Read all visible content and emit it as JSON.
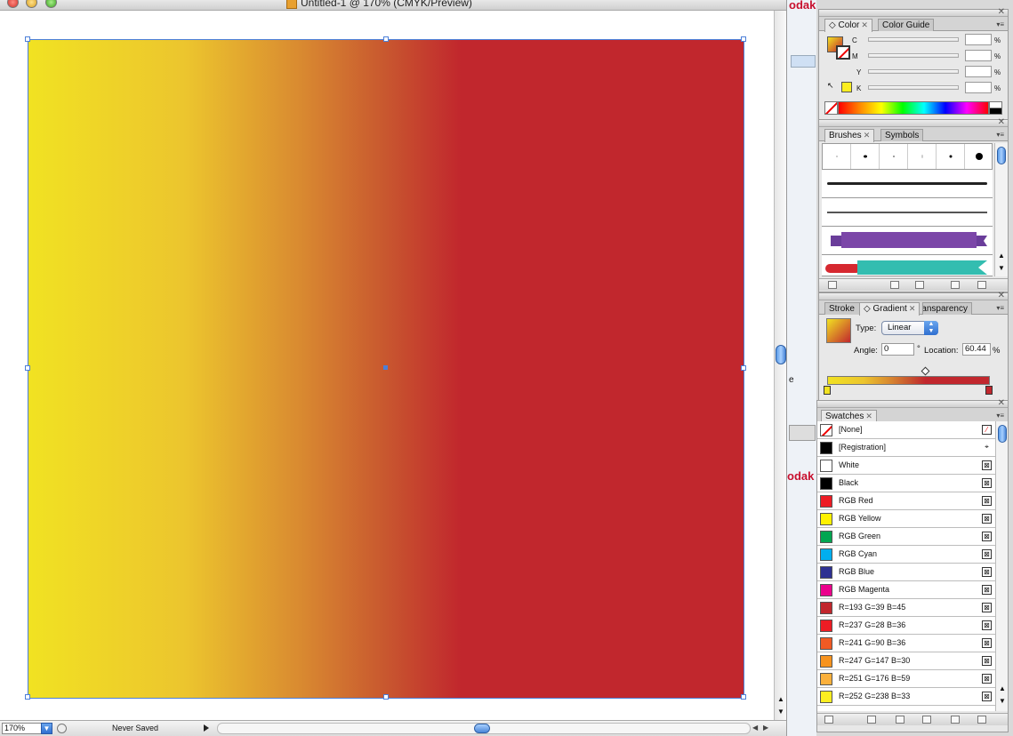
{
  "document": {
    "title": "Untitled-1 @ 170% (CMYK/Preview)",
    "zoom": "170%",
    "status": "Never Saved"
  },
  "color_panel": {
    "tabs": [
      "Color",
      "Color Guide"
    ],
    "channels": [
      "C",
      "M",
      "Y",
      "K"
    ],
    "unit": "%"
  },
  "brushes_panel": {
    "tabs": [
      "Brushes",
      "Symbols"
    ]
  },
  "gradient_panel": {
    "tabs": [
      "Stroke",
      "Gradient",
      "Transparency"
    ],
    "type_label": "Type:",
    "type_value": "Linear",
    "angle_label": "Angle:",
    "angle_value": "0",
    "degree_symbol": "°",
    "location_label": "Location:",
    "location_value": "60.44",
    "location_unit": "%",
    "stops": [
      {
        "color": "#f1e222",
        "position": 0
      },
      {
        "color": "#c1272d",
        "position": 100
      }
    ],
    "midpoint": 60.44
  },
  "swatches_panel": {
    "tab": "Swatches",
    "items": [
      {
        "label": "[None]",
        "color": "none"
      },
      {
        "label": "[Registration]",
        "color": "#000000"
      },
      {
        "label": "White",
        "color": "#ffffff"
      },
      {
        "label": "Black",
        "color": "#000000"
      },
      {
        "label": "RGB Red",
        "color": "#ed1c24"
      },
      {
        "label": "RGB Yellow",
        "color": "#fff200"
      },
      {
        "label": "RGB Green",
        "color": "#00a651"
      },
      {
        "label": "RGB Cyan",
        "color": "#00aeef"
      },
      {
        "label": "RGB Blue",
        "color": "#2e3192"
      },
      {
        "label": "RGB Magenta",
        "color": "#ec008c"
      },
      {
        "label": "R=193 G=39 B=45",
        "color": "#c1272d"
      },
      {
        "label": "R=237 G=28 B=36",
        "color": "#ed1c24"
      },
      {
        "label": "R=241 G=90 B=36",
        "color": "#f15a24"
      },
      {
        "label": "R=247 G=147 B=30",
        "color": "#f7931e"
      },
      {
        "label": "R=251 G=176 B=59",
        "color": "#fbb03b"
      },
      {
        "label": "R=252 G=238 B=33",
        "color": "#fcee21"
      }
    ]
  },
  "background_app": {
    "brand_text": "odak",
    "brand_text_2": "odak",
    "label_e": "e"
  },
  "colors": {
    "gradient_start": "#f1e222",
    "gradient_end": "#c1272d",
    "selection": "#4c7fd8"
  }
}
